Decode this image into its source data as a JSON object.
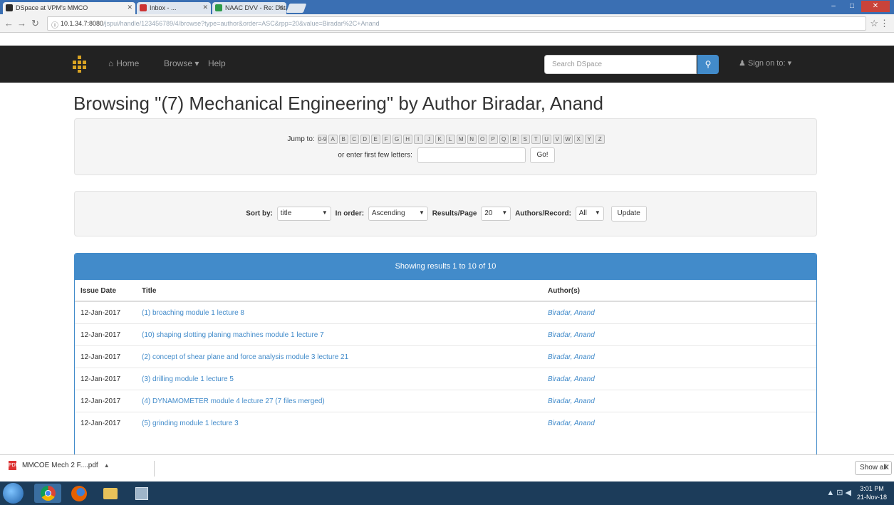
{
  "browser": {
    "tabs": [
      {
        "title": "DSpace at VPM's MMCO",
        "active": true
      },
      {
        "title": "Inbox - ...",
        "active": false
      },
      {
        "title": "NAAC DVV - Re: Datam",
        "active": false
      }
    ],
    "url_host": "10.1.34.7:8080",
    "url_path": "/jspui/handle/123456789/4/browse?type=author&order=ASC&rpp=20&value=Biradar%2C+Anand",
    "window_controls": {
      "minimize": "–",
      "maximize": "□",
      "close": "✕"
    }
  },
  "navbar": {
    "home": "Home",
    "browse": "Browse",
    "help": "Help",
    "search_placeholder": "Search DSpace",
    "signin": "Sign on to:"
  },
  "page": {
    "heading": "Browsing \"(7) Mechanical Engineering\" by Author Biradar, Anand"
  },
  "jump": {
    "label": "Jump to:",
    "buttons": [
      "0-9",
      "A",
      "B",
      "C",
      "D",
      "E",
      "F",
      "G",
      "H",
      "I",
      "J",
      "K",
      "L",
      "M",
      "N",
      "O",
      "P",
      "Q",
      "R",
      "S",
      "T",
      "U",
      "V",
      "W",
      "X",
      "Y",
      "Z"
    ],
    "letters_label": "or enter first few letters:",
    "go_label": "Go!"
  },
  "sort": {
    "sort_by_label": "Sort by:",
    "sort_by_value": "title",
    "in_order_label": "In order:",
    "in_order_value": "Ascending",
    "results_label": "Results/Page",
    "results_value": "20",
    "authors_label": "Authors/Record:",
    "authors_value": "All",
    "update_label": "Update"
  },
  "results": {
    "heading": "Showing results 1 to 10 of 10",
    "columns": [
      "Issue Date",
      "Title",
      "Author(s)"
    ],
    "rows": [
      {
        "date": "12-Jan-2017",
        "title": "(1) broaching module 1 lecture 8",
        "author": "Biradar, Anand"
      },
      {
        "date": "12-Jan-2017",
        "title": "(10) shaping slotting planing machines module 1 lecture 7",
        "author": "Biradar, Anand"
      },
      {
        "date": "12-Jan-2017",
        "title": "(2) concept of shear plane and force analysis module 3 lecture 21",
        "author": "Biradar, Anand"
      },
      {
        "date": "12-Jan-2017",
        "title": "(3) drilling module 1 lecture 5",
        "author": "Biradar, Anand"
      },
      {
        "date": "12-Jan-2017",
        "title": "(4) DYNAMOMETER module 4 lecture 27 (7 files merged)",
        "author": "Biradar, Anand"
      },
      {
        "date": "12-Jan-2017",
        "title": "(5) grinding module 1 lecture 3",
        "author": "Biradar, Anand"
      }
    ]
  },
  "downloads": {
    "file": "MMCOE Mech 2 F....pdf",
    "show_all": "Show all"
  },
  "taskbar": {
    "time": "3:01 PM",
    "date": "21-Nov-18"
  },
  "colors": {
    "primary": "#428bca",
    "navbar_bg": "#222222",
    "logo": "#d9a323"
  }
}
